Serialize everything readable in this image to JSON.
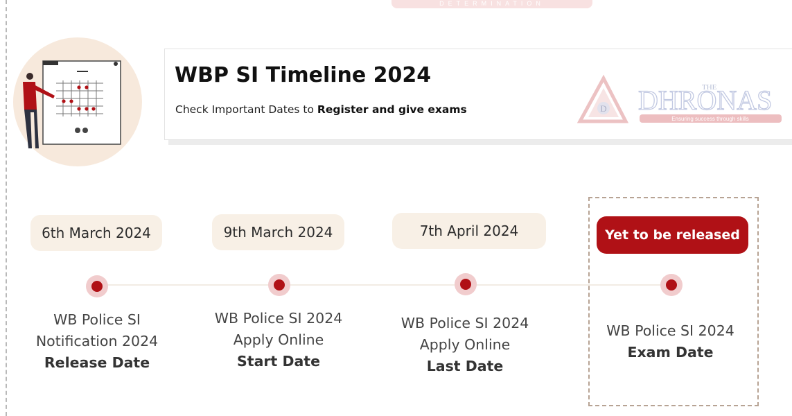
{
  "banner": {
    "text": "DETERMINATION"
  },
  "header": {
    "title": "WBP SI Timeline 2024",
    "subtitle_prefix": "Check Important Dates to ",
    "subtitle_bold": "Register and give exams"
  },
  "logo": {
    "the": "THE",
    "name": "DHRONAS",
    "tagline": "Ensuring success through skills",
    "badge_letter": "D"
  },
  "timeline": [
    {
      "date": "6th March 2024",
      "line1": "WB Police SI",
      "line2": "Notification 2024",
      "emphasis": "Release Date"
    },
    {
      "date": "9th March 2024",
      "line1": "WB Police SI 2024",
      "line2": "Apply Online",
      "emphasis": "Start Date"
    },
    {
      "date": "7th April 2024",
      "line1": "WB Police SI 2024",
      "line2": "Apply Online",
      "emphasis": "Last Date"
    },
    {
      "date": "Yet to be released",
      "line1": "WB Police SI 2024",
      "emphasis": "Exam Date"
    }
  ],
  "colors": {
    "accent": "#b01116",
    "pill": "#f8f0e6",
    "dot_halo": "#f1cccd"
  }
}
